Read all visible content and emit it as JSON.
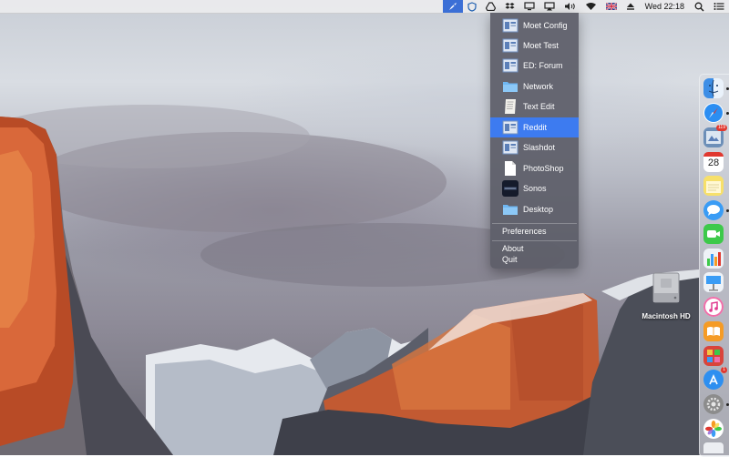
{
  "menubar": {
    "clock": "Wed 22:18",
    "icons": [
      "rocket-icon",
      "shield-icon",
      "drive-icon",
      "dropbox-icon",
      "monitor-icon",
      "airplay-icon",
      "volume-icon",
      "wifi-icon",
      "uk-flag-icon",
      "eject-icon",
      "spotlight-icon",
      "notification-center-icon"
    ]
  },
  "menu": {
    "items": [
      {
        "label": "Moet Config",
        "icon": "window-icon"
      },
      {
        "label": "Moet Test",
        "icon": "window-icon"
      },
      {
        "label": "ED: Forum",
        "icon": "window-icon"
      },
      {
        "label": "Network",
        "icon": "folder-icon"
      },
      {
        "label": "Text Edit",
        "icon": "textedit-icon"
      },
      {
        "label": "Reddit",
        "icon": "window-icon",
        "selected": true
      },
      {
        "label": "Slashdot",
        "icon": "window-icon"
      },
      {
        "label": "PhotoShop",
        "icon": "document-icon"
      },
      {
        "label": "Sonos",
        "icon": "sonos-icon"
      },
      {
        "label": "Desktop",
        "icon": "folder-icon"
      }
    ],
    "preferences": "Preferences",
    "about": "About",
    "quit": "Quit"
  },
  "desktop": {
    "drive_label": "Macintosh HD"
  },
  "dock": {
    "apps": [
      {
        "name": "finder-icon",
        "color": "#4a90e2"
      },
      {
        "name": "safari-icon",
        "color": "#1a7fe8"
      },
      {
        "name": "mail-icon",
        "color": "#6b8fb8",
        "badge": "119"
      },
      {
        "name": "calendar-icon",
        "color": "#ffffff",
        "text": "28"
      },
      {
        "name": "notes-icon",
        "color": "#f5d547"
      },
      {
        "name": "messages-icon",
        "color": "#3a9cf5"
      },
      {
        "name": "facetime-icon",
        "color": "#3dc94a"
      },
      {
        "name": "numbers-icon",
        "color": "#e8eef5"
      },
      {
        "name": "keynote-icon",
        "color": "#e8eef5"
      },
      {
        "name": "itunes-icon",
        "color": "#f06ea9"
      },
      {
        "name": "ibooks-icon",
        "color": "#f59b25"
      },
      {
        "name": "photo-booth-icon",
        "color": "#d9443b"
      },
      {
        "name": "app-store-icon",
        "color": "#2e8ff0",
        "badge": "1"
      },
      {
        "name": "system-preferences-icon",
        "color": "#8c8c8c"
      },
      {
        "name": "photos-icon",
        "color": "#ffffff"
      }
    ],
    "calendar_day": "28",
    "mail_badge": "119",
    "appstore_badge": "1"
  }
}
